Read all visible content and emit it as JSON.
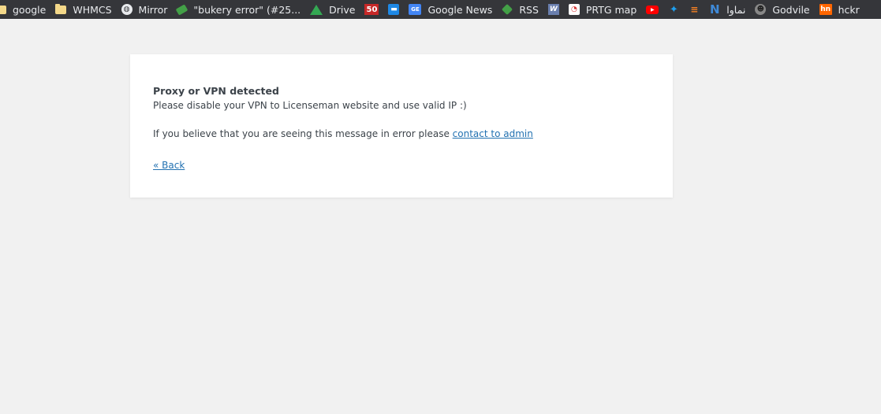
{
  "bookmarks": [
    {
      "label": "google",
      "icon": "folder-icon"
    },
    {
      "label": "WHMCS",
      "icon": "folder-icon"
    },
    {
      "label": "Mirror",
      "icon": "globe-icon"
    },
    {
      "label": "\"bukery error\" (#25...",
      "icon": "tag-icon"
    },
    {
      "label": "Drive",
      "icon": "drive-icon"
    },
    {
      "label": "",
      "icon": "fifty-icon",
      "glyph": "50"
    },
    {
      "label": "",
      "icon": "chat-icon"
    },
    {
      "label": "Google News",
      "icon": "google-news-icon",
      "glyph": "GE"
    },
    {
      "label": "RSS",
      "icon": "rss-icon"
    },
    {
      "label": "",
      "icon": "word-icon",
      "glyph": "W"
    },
    {
      "label": "PRTG map",
      "icon": "prtg-icon"
    },
    {
      "label": "",
      "icon": "youtube-icon"
    },
    {
      "label": "",
      "icon": "twitter-icon"
    },
    {
      "label": "",
      "icon": "stackoverflow-icon"
    },
    {
      "label": "نماوا",
      "icon": "n-icon",
      "glyph": "N"
    },
    {
      "label": "Godvile",
      "icon": "godvile-icon"
    },
    {
      "label": "hckr",
      "icon": "hn-icon",
      "glyph": "hn"
    }
  ],
  "card": {
    "title": "Proxy or VPN detected",
    "message": "Please disable your VPN to Licenseman website and use valid IP :)",
    "error_prefix": "If you believe that you are seeing this message in error please ",
    "contact_link": "contact to admin",
    "back_link": "« Back"
  },
  "colors": {
    "background": "#f1f1f1",
    "bookmark_bar": "#35363a",
    "link": "#2271b1",
    "text": "#3c434a"
  }
}
